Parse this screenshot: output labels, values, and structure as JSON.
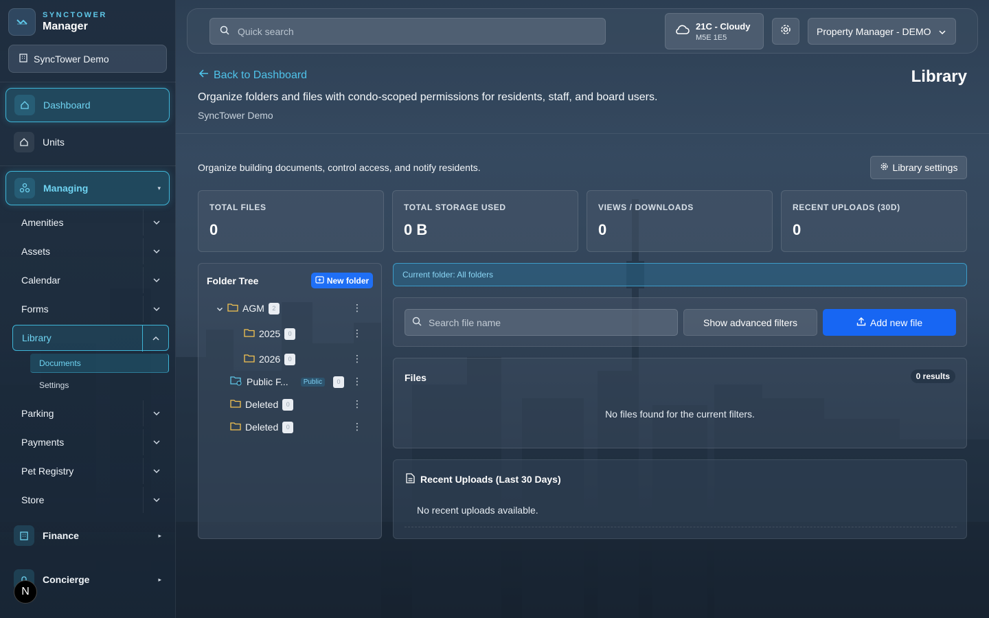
{
  "brand": {
    "kicker": "SYNCTOWER",
    "title": "Manager"
  },
  "org_selector": {
    "label": "SyncTower Demo"
  },
  "sidebar": {
    "dashboard": "Dashboard",
    "units": "Units",
    "managing": "Managing",
    "managing_items": [
      "Amenities",
      "Assets",
      "Calendar",
      "Forms",
      "Library",
      "Parking",
      "Payments",
      "Pet Registry",
      "Store"
    ],
    "library_children": [
      "Documents",
      "Settings"
    ],
    "finance": "Finance",
    "concierge": "Concierge",
    "user_initial": "N"
  },
  "topbar": {
    "search_placeholder": "Quick search",
    "weather_temp": "21C - Cloudy",
    "weather_postal": "M5E 1E5",
    "role": "Property Manager - DEMO"
  },
  "header": {
    "back": "Back to Dashboard",
    "description": "Organize folders and files with condo-scoped permissions for residents, staff, and board users.",
    "org": "SyncTower Demo",
    "title": "Library"
  },
  "main": {
    "intro": "Organize building documents, control access, and notify residents.",
    "library_settings": "Library settings",
    "stats": [
      {
        "label": "TOTAL FILES",
        "value": "0"
      },
      {
        "label": "TOTAL STORAGE USED",
        "value": "0 B"
      },
      {
        "label": "VIEWS / DOWNLOADS",
        "value": "0"
      },
      {
        "label": "RECENT UPLOADS (30D)",
        "value": "0"
      }
    ],
    "tree": {
      "title": "Folder Tree",
      "new_folder": "New folder",
      "nodes": [
        {
          "name": "AGM",
          "count": "2"
        },
        {
          "name": "2025",
          "count": "0"
        },
        {
          "name": "2026",
          "count": "0"
        },
        {
          "name": "Public F...",
          "badge": "Public",
          "count": "0"
        },
        {
          "name": "Deleted",
          "count": "0"
        },
        {
          "name": "Deleted",
          "count": "0"
        }
      ]
    },
    "current_folder": "Current folder: All folders",
    "file_search_placeholder": "Search file name",
    "advanced_filters": "Show advanced filters",
    "add_file": "Add new file",
    "files": {
      "title": "Files",
      "results": "0 results",
      "empty": "No files found for the current filters."
    },
    "recent": {
      "title": "Recent Uploads (Last 30 Days)",
      "empty": "No recent uploads available."
    }
  },
  "colors": {
    "accent": "#3fb6d8",
    "primary_button": "#1766f3",
    "link": "#4fc3ea"
  }
}
